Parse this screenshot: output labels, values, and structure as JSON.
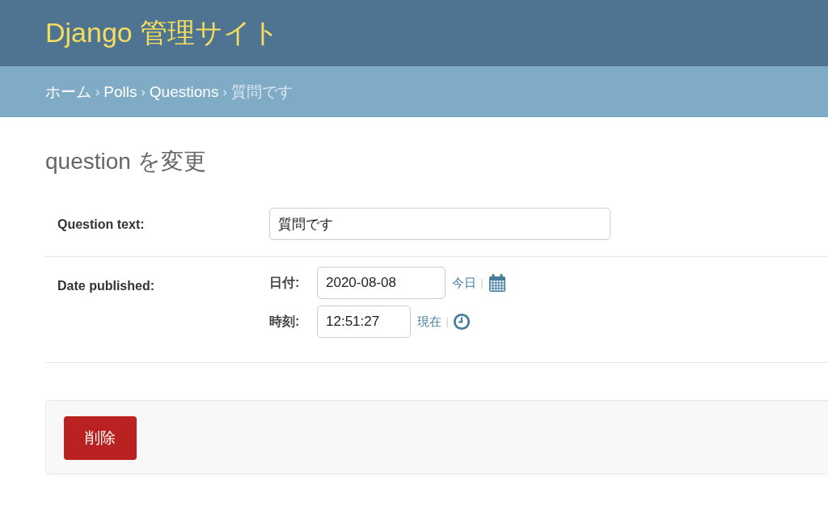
{
  "header": {
    "site_name": "Django 管理サイト"
  },
  "breadcrumbs": {
    "items": [
      {
        "label": "ホーム",
        "kind": "link"
      },
      {
        "label": "Polls",
        "kind": "link"
      },
      {
        "label": "Questions",
        "kind": "link"
      },
      {
        "label": "質問です",
        "kind": "current"
      }
    ],
    "separator": "›"
  },
  "page_title": "question を変更",
  "fields": [
    {
      "label": "Question text:",
      "kind": "text",
      "value": "質問です"
    },
    {
      "label": "Date published:",
      "kind": "datetime",
      "date_label": "日付:",
      "date_value": "2020-08-08",
      "today_link": "今日",
      "time_label": "時刻:",
      "time_value": "12:51:27",
      "now_link": "現在",
      "divider": "|"
    }
  ],
  "submit_row": {
    "delete_button": "削除"
  }
}
